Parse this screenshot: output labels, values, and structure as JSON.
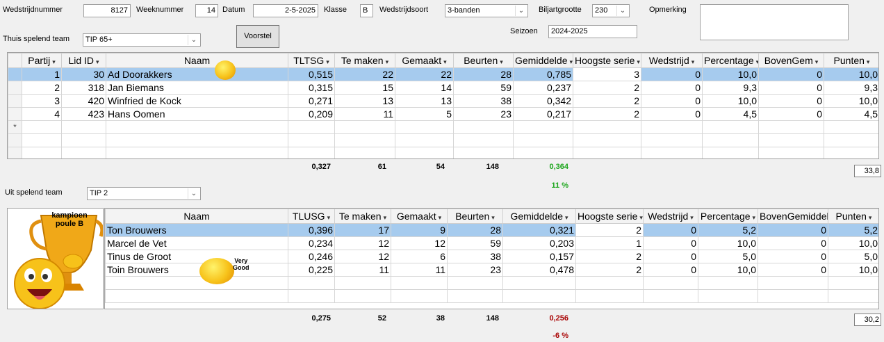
{
  "header": {
    "wedstrijdnummer_label": "Wedstrijdnummer",
    "wedstrijdnummer": "8127",
    "weeknummer_label": "Weeknummer",
    "weeknummer": "14",
    "datum_label": "Datum",
    "datum": "2-5-2025",
    "klasse_label": "Klasse",
    "klasse": "B",
    "wedstrijdsoort_label": "Wedstrijdsoort",
    "wedstrijdsoort": "3-banden",
    "biljartgrootte_label": "Biljartgrootte",
    "biljartgrootte": "230",
    "opmerking_label": "Opmerking",
    "opmerking": "",
    "seizoen_label": "Seizoen",
    "seizoen": "2024-2025",
    "voorstel_button": "Voorstel",
    "thuis_label": "Thuis spelend team",
    "thuis_team": "TIP 65+",
    "uit_label": "Uit spelend team",
    "uit_team": "TIP 2"
  },
  "home_grid": {
    "columns": [
      "Partij",
      "Lid ID",
      "Naam",
      "TLTSG",
      "Te maken",
      "Gemaakt",
      "Beurten",
      "Gemiddelde",
      "Hoogste serie",
      "Wedstrijd",
      "Percentage",
      "BovenGem",
      "Punten"
    ],
    "rows": [
      {
        "partij": "1",
        "lid_id": "30",
        "naam": "Ad Doorakkers",
        "tltsg": "0,515",
        "te_maken": "22",
        "gemaakt": "22",
        "beurten": "28",
        "gemiddelde": "0,785",
        "hoogste_serie": "3",
        "wedstrijd": "0",
        "percentage": "10,0",
        "boven_gem": "0",
        "punten": "10,0"
      },
      {
        "partij": "2",
        "lid_id": "318",
        "naam": "Jan Biemans",
        "tltsg": "0,315",
        "te_maken": "15",
        "gemaakt": "14",
        "beurten": "59",
        "gemiddelde": "0,237",
        "hoogste_serie": "2",
        "wedstrijd": "0",
        "percentage": "9,3",
        "boven_gem": "0",
        "punten": "9,3"
      },
      {
        "partij": "3",
        "lid_id": "420",
        "naam": "Winfried de Kock",
        "tltsg": "0,271",
        "te_maken": "13",
        "gemaakt": "13",
        "beurten": "38",
        "gemiddelde": "0,342",
        "hoogste_serie": "2",
        "wedstrijd": "0",
        "percentage": "10,0",
        "boven_gem": "0",
        "punten": "10,0"
      },
      {
        "partij": "4",
        "lid_id": "423",
        "naam": "Hans Oomen",
        "tltsg": "0,209",
        "te_maken": "11",
        "gemaakt": "5",
        "beurten": "23",
        "gemiddelde": "0,217",
        "hoogste_serie": "2",
        "wedstrijd": "0",
        "percentage": "4,5",
        "boven_gem": "0",
        "punten": "4,5"
      }
    ],
    "new_row_marker": "*",
    "totals": {
      "tltsg": "0,327",
      "te_maken": "61",
      "gemaakt": "54",
      "beurten": "148",
      "gemiddelde": "0,364",
      "percent": "11 %",
      "punten": "33,8"
    }
  },
  "away_grid": {
    "columns": [
      "Naam",
      "TLUSG",
      "Te maken",
      "Gemaakt",
      "Beurten",
      "Gemiddelde",
      "Hoogste serie",
      "Wedstrijd",
      "Percentage",
      "BovenGemiddelde",
      "Punten"
    ],
    "rows": [
      {
        "naam": "Ton Brouwers",
        "tlusg": "0,396",
        "te_maken": "17",
        "gemaakt": "9",
        "beurten": "28",
        "gemiddelde": "0,321",
        "hoogste_serie": "2",
        "wedstrijd": "0",
        "percentage": "5,2",
        "boven_gem": "0",
        "punten": "5,2"
      },
      {
        "naam": "Marcel de Vet",
        "tlusg": "0,234",
        "te_maken": "12",
        "gemaakt": "12",
        "beurten": "59",
        "gemiddelde": "0,203",
        "hoogste_serie": "1",
        "wedstrijd": "0",
        "percentage": "10,0",
        "boven_gem": "0",
        "punten": "10,0"
      },
      {
        "naam": "Tinus de Groot",
        "tlusg": "0,246",
        "te_maken": "12",
        "gemaakt": "6",
        "beurten": "38",
        "gemiddelde": "0,157",
        "hoogste_serie": "2",
        "wedstrijd": "0",
        "percentage": "5,0",
        "boven_gem": "0",
        "punten": "5,0"
      },
      {
        "naam": "Toin Brouwers",
        "tlusg": "0,225",
        "te_maken": "11",
        "gemaakt": "11",
        "beurten": "23",
        "gemiddelde": "0,478",
        "hoogste_serie": "2",
        "wedstrijd": "0",
        "percentage": "10,0",
        "boven_gem": "0",
        "punten": "10,0"
      }
    ],
    "totals": {
      "tlusg": "0,275",
      "te_maken": "52",
      "gemaakt": "38",
      "beurten": "148",
      "gemiddelde": "0,256",
      "percent": "-6 %",
      "punten": "30,2"
    }
  },
  "decorations": {
    "trophy_text_1": "kampioen",
    "trophy_text_2": "poule B",
    "very_good_1": "Very",
    "very_good_2": "Good"
  },
  "colors": {
    "selected_row": "#a6cbee",
    "positive_total": "#1aa51a",
    "negative_total": "#a80000",
    "trophy_gold": "#f0a818"
  }
}
